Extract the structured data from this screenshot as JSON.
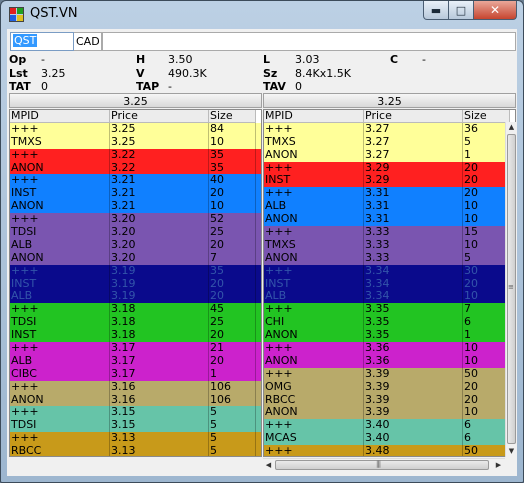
{
  "window": {
    "title": "QST.VN",
    "icon": "level2-app-icon"
  },
  "toolbar": {
    "symbol": "QST",
    "exchange": "CAD",
    "extra": ""
  },
  "quote": {
    "op": {
      "label": "Op",
      "value": "-"
    },
    "h": {
      "label": "H",
      "value": "3.50"
    },
    "l": {
      "label": "L",
      "value": "3.03"
    },
    "c": {
      "label": "C",
      "value": "-"
    },
    "lst": {
      "label": "Lst",
      "value": "3.25"
    },
    "v": {
      "label": "V",
      "value": "490.3K"
    },
    "sz": {
      "label": "Sz",
      "value": "8.4Kx1.5K"
    },
    "tat": {
      "label": "TAT",
      "value": "0"
    },
    "tap": {
      "label": "TAP",
      "value": "-"
    },
    "tav": {
      "label": "TAV",
      "value": "0"
    }
  },
  "bid_header": "3.25",
  "ask_header": "3.25",
  "columns": [
    "MPID",
    "Price",
    "Size"
  ],
  "bids": [
    {
      "mpid": "+++",
      "price": "3.25",
      "size": "84",
      "color": "#ffff99"
    },
    {
      "mpid": "TMXS",
      "price": "3.25",
      "size": "10",
      "color": "#ffff99"
    },
    {
      "mpid": "+++",
      "price": "3.22",
      "size": "35",
      "color": "#ff2020"
    },
    {
      "mpid": "ANON",
      "price": "3.22",
      "size": "35",
      "color": "#ff2020"
    },
    {
      "mpid": "+++",
      "price": "3.21",
      "size": "40",
      "color": "#1080ff"
    },
    {
      "mpid": "INST",
      "price": "3.21",
      "size": "20",
      "color": "#1080ff"
    },
    {
      "mpid": "ANON",
      "price": "3.21",
      "size": "10",
      "color": "#1080ff"
    },
    {
      "mpid": "+++",
      "price": "3.20",
      "size": "52",
      "color": "#7a55b0"
    },
    {
      "mpid": "TDSI",
      "price": "3.20",
      "size": "25",
      "color": "#7a55b0"
    },
    {
      "mpid": "ALB",
      "price": "3.20",
      "size": "20",
      "color": "#7a55b0"
    },
    {
      "mpid": "ANON",
      "price": "3.20",
      "size": "7",
      "color": "#7a55b0"
    },
    {
      "mpid": "+++",
      "price": "3.19",
      "size": "35",
      "color": "#0a0a8c"
    },
    {
      "mpid": "INST",
      "price": "3.19",
      "size": "20",
      "color": "#0a0a8c"
    },
    {
      "mpid": "ALB",
      "price": "3.19",
      "size": "20",
      "color": "#0a0a8c"
    },
    {
      "mpid": "+++",
      "price": "3.18",
      "size": "45",
      "color": "#22c422"
    },
    {
      "mpid": "TDSI",
      "price": "3.18",
      "size": "25",
      "color": "#22c422"
    },
    {
      "mpid": "INST",
      "price": "3.18",
      "size": "20",
      "color": "#22c422"
    },
    {
      "mpid": "+++",
      "price": "3.17",
      "size": "21",
      "color": "#cc22cc"
    },
    {
      "mpid": "ALB",
      "price": "3.17",
      "size": "20",
      "color": "#cc22cc"
    },
    {
      "mpid": "CIBC",
      "price": "3.17",
      "size": "1",
      "color": "#cc22cc"
    },
    {
      "mpid": "+++",
      "price": "3.16",
      "size": "106",
      "color": "#b8aa6a"
    },
    {
      "mpid": "ANON",
      "price": "3.16",
      "size": "106",
      "color": "#b8aa6a"
    },
    {
      "mpid": "+++",
      "price": "3.15",
      "size": "5",
      "color": "#66c4a8"
    },
    {
      "mpid": "TDSI",
      "price": "3.15",
      "size": "5",
      "color": "#66c4a8"
    },
    {
      "mpid": "+++",
      "price": "3.13",
      "size": "5",
      "color": "#c89a1a"
    },
    {
      "mpid": "RBCC",
      "price": "3.13",
      "size": "5",
      "color": "#c89a1a"
    }
  ],
  "asks": [
    {
      "mpid": "+++",
      "price": "3.27",
      "size": "36",
      "color": "#ffff99"
    },
    {
      "mpid": "TMXS",
      "price": "3.27",
      "size": "5",
      "color": "#ffff99"
    },
    {
      "mpid": "ANON",
      "price": "3.27",
      "size": "1",
      "color": "#ffff99"
    },
    {
      "mpid": "+++",
      "price": "3.29",
      "size": "20",
      "color": "#ff2020"
    },
    {
      "mpid": "INST",
      "price": "3.29",
      "size": "20",
      "color": "#ff2020"
    },
    {
      "mpid": "+++",
      "price": "3.31",
      "size": "20",
      "color": "#1080ff"
    },
    {
      "mpid": "ALB",
      "price": "3.31",
      "size": "10",
      "color": "#1080ff"
    },
    {
      "mpid": "ANON",
      "price": "3.31",
      "size": "10",
      "color": "#1080ff"
    },
    {
      "mpid": "+++",
      "price": "3.33",
      "size": "15",
      "color": "#7a55b0"
    },
    {
      "mpid": "TMXS",
      "price": "3.33",
      "size": "10",
      "color": "#7a55b0"
    },
    {
      "mpid": "ANON",
      "price": "3.33",
      "size": "5",
      "color": "#7a55b0"
    },
    {
      "mpid": "+++",
      "price": "3.34",
      "size": "30",
      "color": "#0a0a8c"
    },
    {
      "mpid": "INST",
      "price": "3.34",
      "size": "20",
      "color": "#0a0a8c"
    },
    {
      "mpid": "ALB",
      "price": "3.34",
      "size": "10",
      "color": "#0a0a8c"
    },
    {
      "mpid": "+++",
      "price": "3.35",
      "size": "7",
      "color": "#22c422"
    },
    {
      "mpid": "CHI",
      "price": "3.35",
      "size": "6",
      "color": "#22c422"
    },
    {
      "mpid": "ANON",
      "price": "3.35",
      "size": "1",
      "color": "#22c422"
    },
    {
      "mpid": "+++",
      "price": "3.36",
      "size": "10",
      "color": "#cc22cc"
    },
    {
      "mpid": "ANON",
      "price": "3.36",
      "size": "10",
      "color": "#cc22cc"
    },
    {
      "mpid": "+++",
      "price": "3.39",
      "size": "50",
      "color": "#b8aa6a"
    },
    {
      "mpid": "OMG",
      "price": "3.39",
      "size": "20",
      "color": "#b8aa6a"
    },
    {
      "mpid": "RBCC",
      "price": "3.39",
      "size": "20",
      "color": "#b8aa6a"
    },
    {
      "mpid": "ANON",
      "price": "3.39",
      "size": "10",
      "color": "#b8aa6a"
    },
    {
      "mpid": "+++",
      "price": "3.40",
      "size": "6",
      "color": "#66c4a8"
    },
    {
      "mpid": "MCAS",
      "price": "3.40",
      "size": "6",
      "color": "#66c4a8"
    },
    {
      "mpid": "+++",
      "price": "3.48",
      "size": "50",
      "color": "#c89a1a"
    }
  ]
}
